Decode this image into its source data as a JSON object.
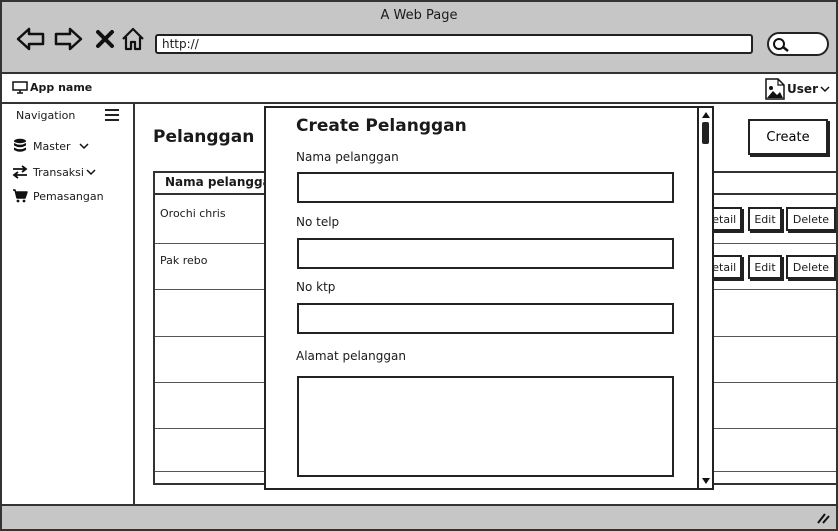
{
  "window": {
    "title": "A Web Page",
    "url": "http://"
  },
  "appbar": {
    "app_name": "App name",
    "user_label": "User"
  },
  "sidebar": {
    "heading": "Navigation",
    "items": [
      {
        "label": "Master",
        "icon": "database-icon",
        "has_chevron": true
      },
      {
        "label": "Transaksi",
        "icon": "transfer-icon",
        "has_chevron": true
      },
      {
        "label": "Pemasangan",
        "icon": "cart-icon",
        "has_chevron": false
      }
    ]
  },
  "main": {
    "page_title": "Pelanggan",
    "create_label": "Create",
    "table": {
      "column_header": "Nama pelanggan",
      "rows": [
        {
          "name": "Orochi chris",
          "detail": "Detail",
          "edit": "Edit",
          "delete": "Delete"
        },
        {
          "name": "Pak rebo",
          "detail": "Detail",
          "edit": "Edit",
          "delete": "Delete"
        }
      ]
    }
  },
  "modal": {
    "title": "Create Pelanggan",
    "fields": [
      {
        "label": "Nama pelanggan",
        "value": ""
      },
      {
        "label": "No telp",
        "value": ""
      },
      {
        "label": "No ktp",
        "value": ""
      },
      {
        "label": "Alamat pelanggan",
        "value": ""
      }
    ]
  }
}
